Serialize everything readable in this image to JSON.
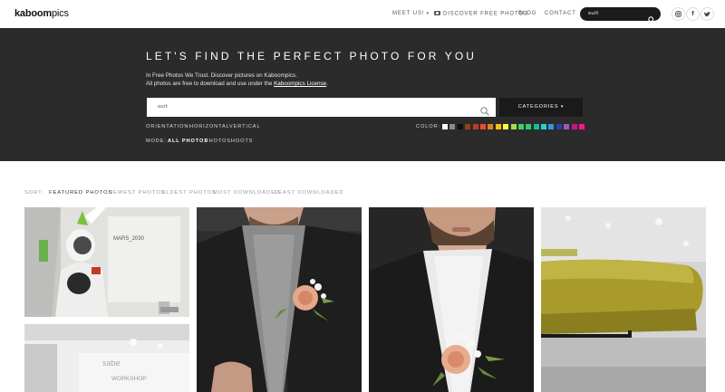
{
  "header": {
    "logo_bold": "kaboom",
    "logo_thin": "pics",
    "nav": {
      "meet_us": "MEET US!",
      "discover": "DISCOVER FREE PHOTOS",
      "blog": "BLOG",
      "contact": "CONTACT"
    },
    "search_value": "suit",
    "social": [
      "instagram-icon",
      "facebook-icon",
      "twitter-icon"
    ]
  },
  "hero": {
    "title": "LET'S FIND THE PERFECT PHOTO FOR YOU",
    "line1": "In Free Photos We Trust. Discover pictures on Kaboompics.",
    "line2_prefix": "All photos are free to download and use under the",
    "line2_link": "Kaboompics License",
    "line2_suffix": ".",
    "search_value": "suit",
    "categories_label": "CATEGORIES",
    "orientation_label": "ORIENTATION:",
    "orientation_options": [
      "HORIZONTAL",
      "VERTICAL"
    ],
    "color_label": "COLOR:",
    "colors": [
      "#ffffff",
      "#8a8a8a",
      "#111111",
      "#8b4513",
      "#c0392b",
      "#e74c3c",
      "#e67e22",
      "#f1c40f",
      "#ffff33",
      "#a4e04a",
      "#3fd16b",
      "#2ecc71",
      "#1abc9c",
      "#33cccc",
      "#3498db",
      "#2c3eaf",
      "#9b59b6",
      "#c71585",
      "#ff1493"
    ],
    "mode_label": "MODE:",
    "mode_options": [
      "ALL PHOTOS",
      "PHOTOSHOOTS"
    ],
    "mode_active": "ALL PHOTOS"
  },
  "sort": {
    "label": "SORT:",
    "options": [
      "FEATURED PHOTOS",
      "NEWEST PHOTOS",
      "OLDEST PHOTOS",
      "MOST DOWNLOADED",
      "LEAST DOWNLOADED"
    ],
    "active": "FEATURED PHOTOS"
  },
  "photos": {
    "p1_sign": "MARS_2030",
    "p2_sign_a": "sabe",
    "p2_sign_b": "WORKSHOP"
  }
}
